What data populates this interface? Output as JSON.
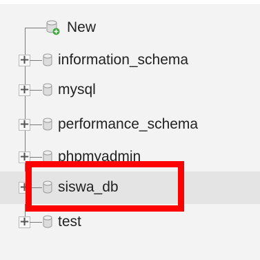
{
  "tree": {
    "new_item": {
      "label": "New",
      "icon": "new-database-icon"
    },
    "databases": [
      {
        "label": "information_schema",
        "icon": "database-icon",
        "expander": "+"
      },
      {
        "label": "mysql",
        "icon": "database-icon",
        "expander": "+"
      },
      {
        "label": "performance_schema",
        "icon": "database-icon",
        "expander": "+"
      },
      {
        "label": "phpmyadmin",
        "icon": "database-icon",
        "expander": "+"
      },
      {
        "label": "siswa_db",
        "icon": "database-icon",
        "expander": "+",
        "highlighted": true
      },
      {
        "label": "test",
        "icon": "database-icon",
        "expander": "+"
      }
    ]
  },
  "colors": {
    "highlight_box": "#ff0000",
    "row_highlight": "#e4e4e4",
    "new_badge": "#3aa63a"
  }
}
